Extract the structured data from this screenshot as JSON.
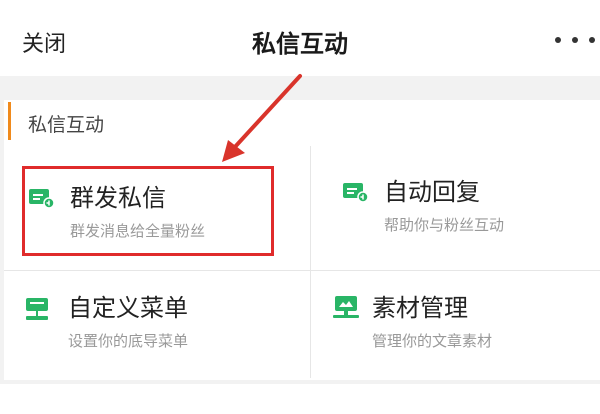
{
  "header": {
    "close_label": "关闭",
    "title": "私信互动",
    "more_icon": "more-dots-icon"
  },
  "section": {
    "title": "私信互动",
    "accent_color": "#f08a1c"
  },
  "cards": [
    {
      "name": "群发私信",
      "desc": "群发消息给全量粉丝",
      "icon": "mass-message-icon"
    },
    {
      "name": "自动回复",
      "desc": "帮助你与粉丝互动",
      "icon": "auto-reply-icon"
    },
    {
      "name": "自定义菜单",
      "desc": "设置你的底导菜单",
      "icon": "custom-menu-icon"
    },
    {
      "name": "素材管理",
      "desc": "管理你的文章素材",
      "icon": "material-manage-icon"
    }
  ],
  "colors": {
    "icon_green": "#29b566",
    "highlight_red": "#e02b2b",
    "arrow_red": "#d9342b"
  }
}
